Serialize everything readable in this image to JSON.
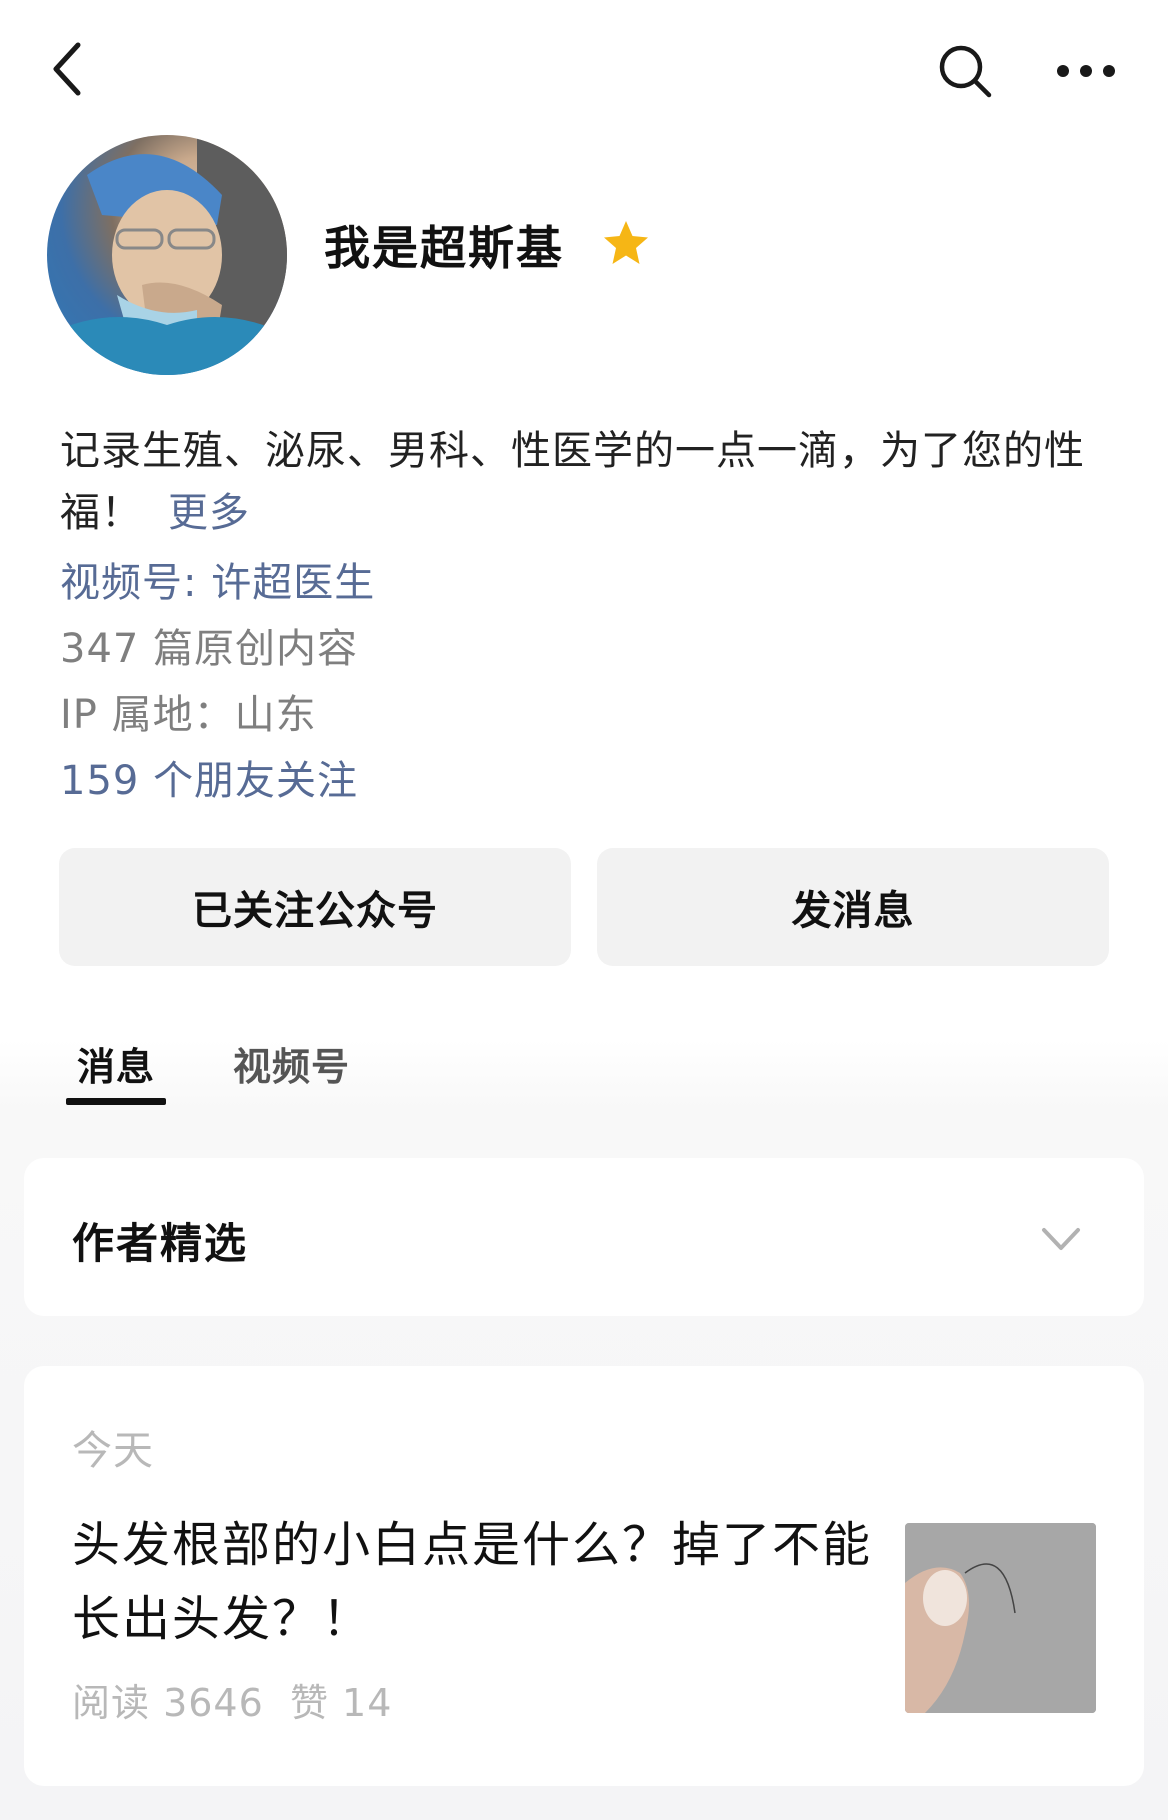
{
  "profile": {
    "name": "我是超斯基",
    "bio": "记录生殖、泌尿、男科、性医学的一点一滴，为了您的性福！",
    "bio_more": "更多",
    "channel": "视频号: 许超医生",
    "original_count": "347 篇原创内容",
    "ip_location": "IP 属地：山东",
    "friends_follow": "159 个朋友关注"
  },
  "actions": {
    "followed_label": "已关注公众号",
    "message_label": "发消息"
  },
  "tabs": [
    {
      "label": "消息",
      "active": true
    },
    {
      "label": "视频号",
      "active": false
    }
  ],
  "featured": {
    "title": "作者精选"
  },
  "article": {
    "date": "今天",
    "title": "头发根部的小白点是什么？掉了不能长出头发？！",
    "reads": "阅读 3646",
    "likes": "赞 14"
  },
  "icons": {
    "back": "chevron-left-icon",
    "search": "search-icon",
    "more": "more-dots-icon",
    "verified": "star-icon",
    "expand": "chevron-down-icon"
  },
  "colors": {
    "link": "#576b95",
    "star": "#f6b615",
    "muted": "#7f7f7f"
  }
}
